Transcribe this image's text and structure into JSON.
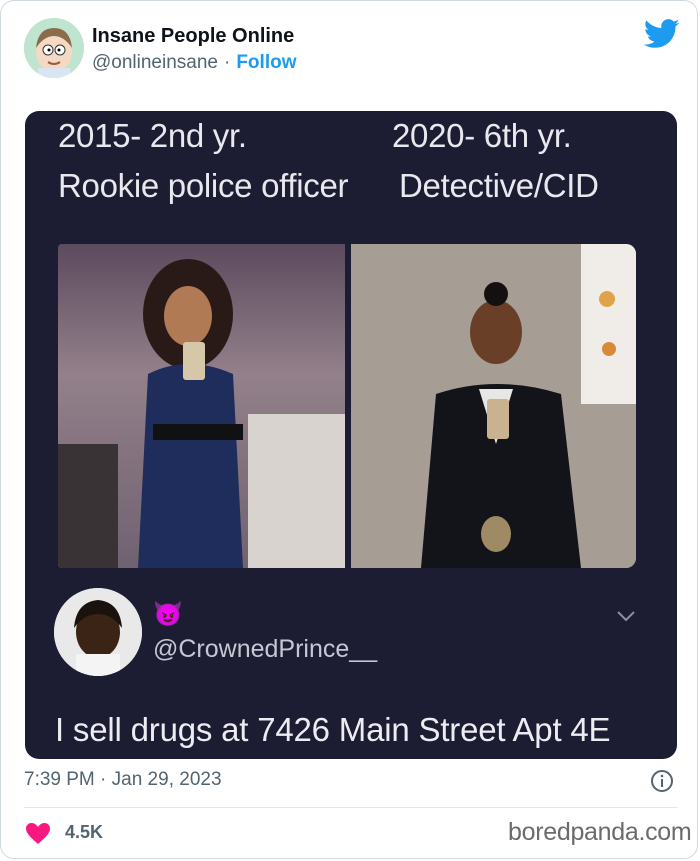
{
  "tweet": {
    "author_name": "Insane People Online",
    "handle": "@onlineinsane",
    "separator": "·",
    "follow_label": "Follow",
    "timestamp": "7:39 PM · Jan 29, 2023",
    "likes": "4.5K",
    "brand_color": "#1d9bf0",
    "heart_color": "#f91880"
  },
  "meme": {
    "left_year": "2015- 2nd yr.",
    "left_title": "Rookie police officer",
    "right_year": "2020- 6th yr.",
    "right_title": "Detective/CID",
    "reply_emoji": "😈",
    "reply_handle": "@CrownedPrince__",
    "reply_text": "I sell drugs at 7426 Main Street Apt 4E"
  },
  "icons": {
    "brand": "twitter-bird-icon",
    "info": "info-icon",
    "like": "heart-icon",
    "more": "chevron-down-icon"
  },
  "watermark": "boredpanda.com"
}
